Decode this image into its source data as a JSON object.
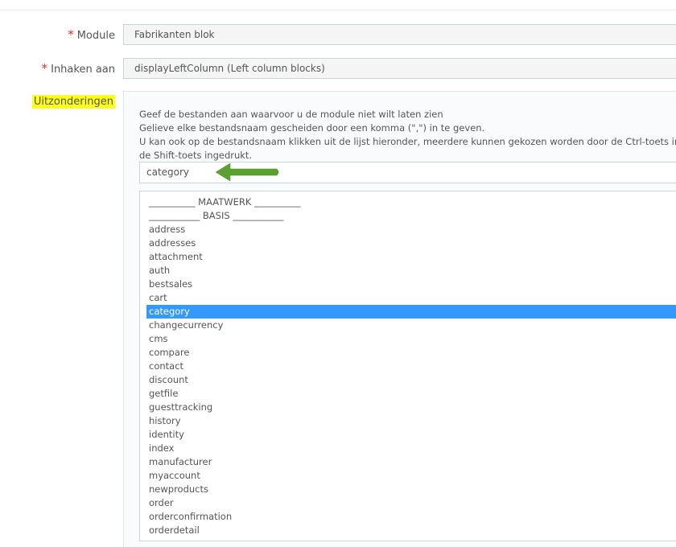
{
  "form": {
    "module": {
      "label": "Module",
      "required_mark": "*",
      "value": "Fabrikanten blok"
    },
    "hook": {
      "label": "Inhaken aan",
      "required_mark": "*",
      "value": "displayLeftColumn (Left column blocks)"
    },
    "exceptions": {
      "label": "Uitzonderingen",
      "help_lines": [
        "Geef de bestanden aan waarvoor u de module niet wilt laten zien",
        "Gelieve elke bestandsnaam gescheiden door een komma (\",\") in te geven.",
        "U kan ook op de bestandsnaam klikken uit de lijst hieronder, meerdere kunnen gekozen worden door de Ctrl-toets inge",
        "de Shift-toets ingedrukt."
      ],
      "input_value": "category",
      "arrow_color": "#5ba12f",
      "highlight_color": "#fdfd1e",
      "selected_color": "#3399ff",
      "list": {
        "options": [
          "__________ MAATWERK __________",
          "___________ BASIS ___________",
          "address",
          "addresses",
          "attachment",
          "auth",
          "bestsales",
          "cart",
          "category",
          "changecurrency",
          "cms",
          "compare",
          "contact",
          "discount",
          "getfile",
          "guesttracking",
          "history",
          "identity",
          "index",
          "manufacturer",
          "myaccount",
          "newproducts",
          "order",
          "orderconfirmation",
          "orderdetail"
        ],
        "selected": "category"
      }
    }
  }
}
